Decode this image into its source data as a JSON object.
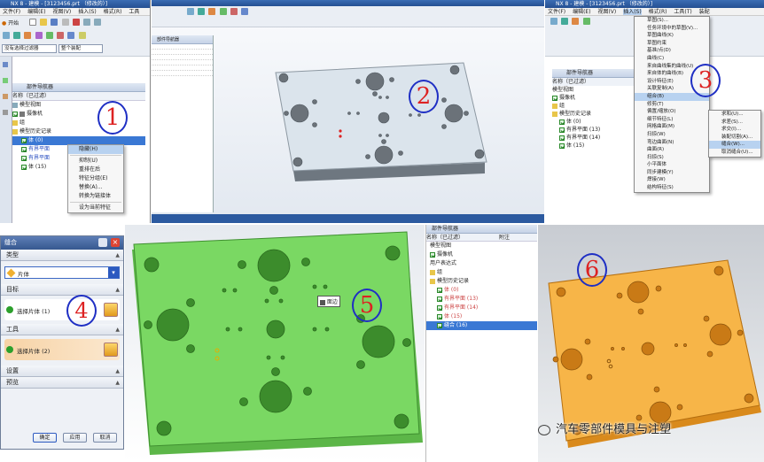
{
  "panel1": {
    "title": "NX 8 - 建模 - [3123456.prt （修改的）]",
    "menu": [
      "文件(F)",
      "编辑(E)",
      "视图(V)",
      "插入(S)",
      "格式(R)",
      "工具"
    ],
    "start_label": "开始",
    "filter_value": "没有选择过滤器",
    "assembly_value": "整个装配",
    "nav_title": "部件导航器",
    "col_name": "名称（已过滤）",
    "tree": [
      "模型视图",
      "摄像机",
      "组",
      "模型历史记录",
      "体 (0)",
      "有界平面",
      "有界平面",
      "体 (15)"
    ],
    "context_menu": [
      "隐藏(H)",
      "抑制(U)",
      "重排在后",
      "特征分组(E)",
      "替换(A)...",
      "转换为链接体",
      "设为当前特征"
    ],
    "badge": "1"
  },
  "panel2": {
    "nav_title": "部件导航器",
    "badge": "2"
  },
  "panel3": {
    "title": "NX 8 - 建模 - [3123456.prt （修改的）]",
    "menu": [
      "文件(F)",
      "编辑(E)",
      "视图(V)",
      "插入(S)",
      "格式(R)",
      "工具(T)",
      "装配"
    ],
    "nav_title": "部件导航器",
    "col_name": "名称（已过滤）",
    "tree": [
      "模型视图",
      "摄像机",
      "组",
      "模型历史记录",
      "体 (0)",
      "有界平面 (13)",
      "有界平面 (14)",
      "体 (15)"
    ],
    "insert_menu": [
      "草图(S)...",
      "任务环境中的草图(V)...",
      "草图曲线(K)",
      "草图约束",
      "基准/点(D)",
      "曲线(C)",
      "来自曲线集的曲线(U)",
      "来自体的曲线(B)",
      "设计特征(E)",
      "关联复制(A)",
      "组合(B)",
      "修剪(T)",
      "偏置/缩放(O)",
      "细节特征(L)",
      "网格曲面(M)",
      "扫掠(W)",
      "弯边曲面(N)",
      "曲面(R)",
      "扫掠(S)",
      "小平面体",
      "同步建模(Y)",
      "焊接(W)",
      "结构特征(S)"
    ],
    "sub_menu": [
      "求和(U)...",
      "求差(S)...",
      "求交(I)...",
      "装配切割(A)...",
      "缝合(W)...",
      "取消缝合(U)..."
    ],
    "badge": "3"
  },
  "panel4": {
    "title": "缝合",
    "section_type": "类型",
    "type_value": "片体",
    "section_target": "目标",
    "target_label": "选择片体 (1)",
    "section_tool": "工具",
    "tool_label": "选择片体 (2)",
    "section_settings": "设置",
    "section_preview": "预览",
    "btn_ok": "确定",
    "btn_apply": "应用",
    "btn_cancel": "取消",
    "badge": "4"
  },
  "panel5": {
    "tooltip": "面边",
    "badge": "5"
  },
  "panel5b": {
    "nav_title": "部件导航器",
    "col_name": "名称（已过滤）",
    "col_note": "附注",
    "tree": [
      "模型视图",
      "摄像机",
      "用户表达式",
      "组",
      "模型历史记录",
      "体 (0)",
      "有界平面 (13)",
      "有界平面 (14)",
      "体 (15)",
      "缝合 (16)"
    ]
  },
  "panel6": {
    "badge": "6",
    "watermark": "汽车零部件模具与注塑"
  },
  "colors": {
    "accent": "#1f2fc4",
    "badge_text": "#d22222",
    "plate_grey": "#d9e2ea",
    "plate_green": "#74d65e",
    "plate_orange": "#f2a93a"
  }
}
